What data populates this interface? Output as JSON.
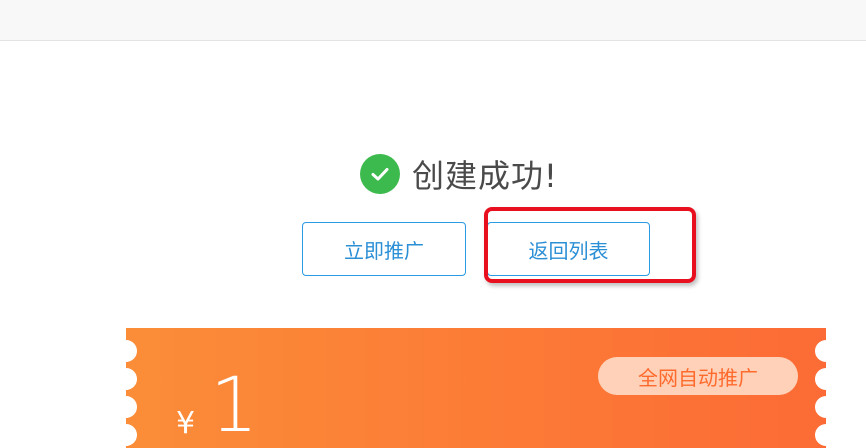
{
  "success": {
    "message": "创建成功!"
  },
  "actions": {
    "promote_label": "立即推广",
    "back_label": "返回列表"
  },
  "coupon": {
    "currency_symbol": "¥",
    "amount": "1",
    "tag_label": "全网自动推广"
  },
  "colors": {
    "success_green": "#3dba4e",
    "button_blue": "#2b9be5",
    "highlight_red": "#e8101f",
    "coupon_orange_start": "#fb8d38",
    "coupon_orange_end": "#fc6b35"
  }
}
